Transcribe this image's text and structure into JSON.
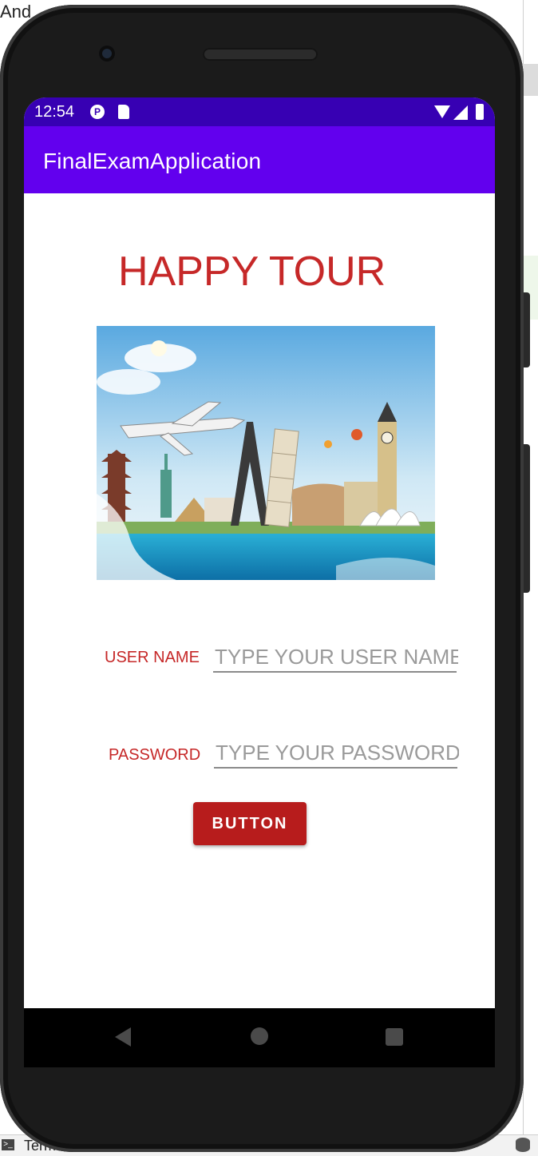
{
  "ide": {
    "top_text": "And",
    "bottom_text": "Term"
  },
  "status_bar": {
    "time": "12:54"
  },
  "app_bar": {
    "title": "FinalExamApplication"
  },
  "main": {
    "headline": "HAPPY TOUR",
    "hero_image": "travel-landmarks-collage",
    "username": {
      "label": "USER NAME",
      "placeholder": "TYPE YOUR USER NAME",
      "value": ""
    },
    "password": {
      "label": "PASSWORD",
      "placeholder": "TYPE YOUR PASSWORD",
      "value": ""
    },
    "button_label": "BUTTON"
  },
  "colors": {
    "status_bar": "#3700b3",
    "app_bar": "#6200ee",
    "accent_text": "#c62828",
    "button": "#b71c1c"
  },
  "icons": [
    "data-saver-icon",
    "sd-card-icon",
    "wifi-icon",
    "signal-icon",
    "battery-icon",
    "back-icon",
    "home-icon",
    "recents-icon"
  ]
}
